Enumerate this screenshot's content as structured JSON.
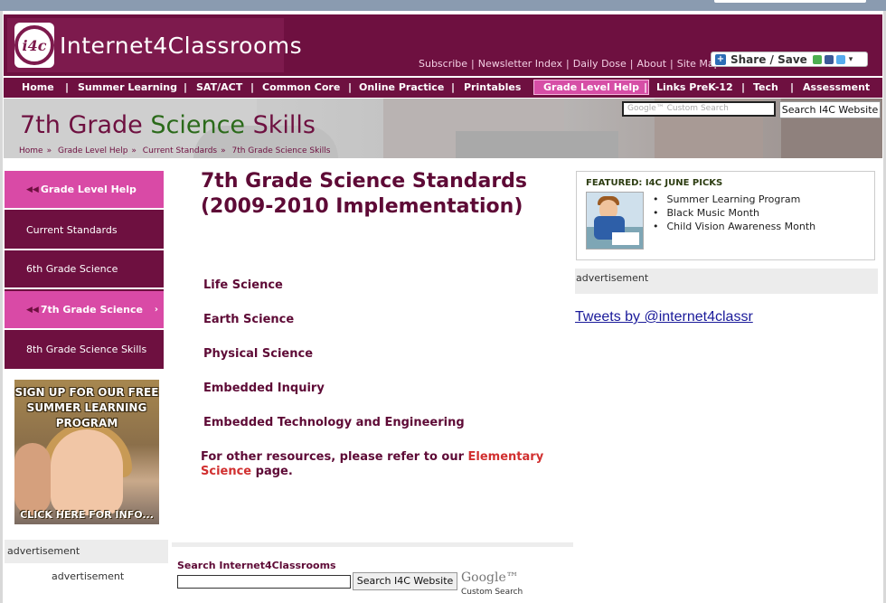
{
  "header": {
    "logo_mark": "i4c",
    "logo_text": "Internet4Classrooms",
    "top_links": [
      "Subscribe",
      "Newsletter Index",
      "Daily Dose",
      "About",
      "Site Map"
    ],
    "share_label": "Share / Save"
  },
  "nav": {
    "items": [
      "Home",
      "Summer Learning",
      "SAT/ACT",
      "Common Core",
      "Online Practice",
      "Printables",
      "Grade Level Help",
      "Links PreK-12",
      "Tech",
      "Assessment"
    ],
    "active": "Grade Level Help"
  },
  "banner": {
    "title_part1": "7th Grade ",
    "title_part2": "Science",
    "title_part3": " Skills",
    "breadcrumbs": [
      "Home",
      "Grade Level Help",
      "Current Standards",
      "7th Grade Science Skills"
    ],
    "search_placeholder": "Google™ Custom Search",
    "search_button": "Search I4C Website"
  },
  "sidebar": {
    "items": [
      {
        "label": "Grade Level Help",
        "highlight": true
      },
      {
        "label": "Current Standards",
        "highlight": false
      },
      {
        "label": "6th Grade Science",
        "highlight": false
      },
      {
        "label": "7th Grade Science",
        "highlight": true
      },
      {
        "label": "8th Grade Science Skills",
        "highlight": false
      }
    ],
    "promo_text": "SIGN UP FOR OUR FREE SUMMER LEARNING PROGRAM",
    "promo_cta": "CLICK HERE FOR INFO...",
    "ad_label": "advertisement",
    "ad_label2": "advertisement"
  },
  "main": {
    "title_line1": "7th Grade Science Standards",
    "title_line2": "(2009-2010 Implementation)",
    "sections": [
      "Life Science",
      "Earth Science",
      "Physical Science",
      "Embedded Inquiry",
      "Embedded Technology and Engineering"
    ],
    "note_prefix": "For other resources, please refer to our ",
    "note_link": "Elementary Science",
    "note_suffix": " page.",
    "search_label": "Search Internet4Classrooms",
    "search_button": "Search I4C Website",
    "google_logo": "Google™",
    "google_sub": "Custom Search"
  },
  "right": {
    "featured_title": "FEATURED: I4C JUNE PICKS",
    "featured_items": [
      "Summer Learning Program",
      "Black Music Month",
      "Child Vision Awareness Month"
    ],
    "ad_label": "advertisement",
    "tweets_link": "Tweets by @internet4classr"
  }
}
